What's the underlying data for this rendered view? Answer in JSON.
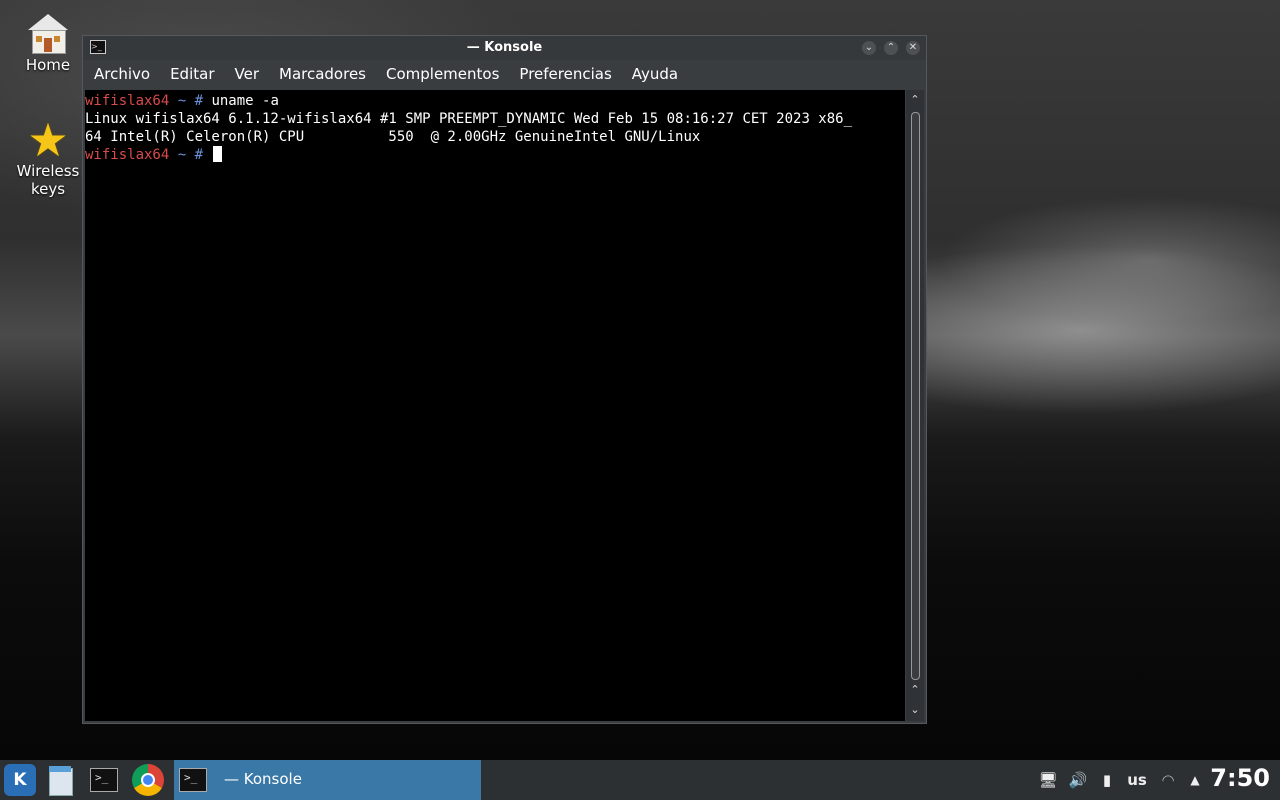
{
  "desktop": {
    "icons": [
      {
        "label": "Home",
        "icon": "house-icon"
      },
      {
        "label": "Wireless keys",
        "icon": "star-icon"
      }
    ]
  },
  "window": {
    "title": "— Konsole",
    "buttons": {
      "minimize": "⌄",
      "maximize": "⌃",
      "close": "✕"
    },
    "menu": [
      "Archivo",
      "Editar",
      "Ver",
      "Marcadores",
      "Complementos",
      "Preferencias",
      "Ayuda"
    ]
  },
  "terminal": {
    "prompt_host": "wifislax64",
    "prompt_sym": " ~ # ",
    "command": "uname -a",
    "output_line1": "Linux wifislax64 6.1.12-wifislax64 #1 SMP PREEMPT_DYNAMIC Wed Feb 15 08:16:27 CET 2023 x86_",
    "output_line2": "64 Intel(R) Celeron(R) CPU          550  @ 2.00GHz GenuineIntel GNU/Linux"
  },
  "taskbar": {
    "active_task": "— Konsole",
    "kde_label": "K",
    "keyboard_layout": "us",
    "clock": "7:50"
  },
  "colors": {
    "prompt_host": "#d94a4a",
    "prompt_sym": "#6a8fd8",
    "active_task_bg": "#3a78a8"
  }
}
